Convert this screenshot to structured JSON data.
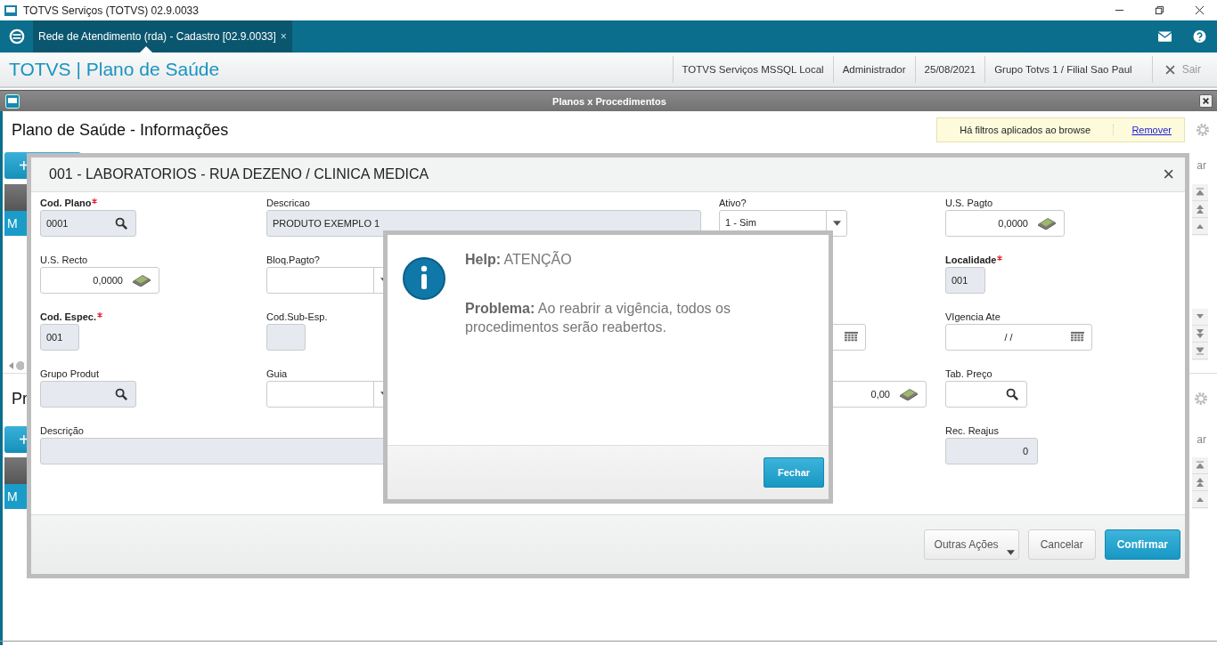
{
  "window": {
    "title": "TOTVS Serviços (TOTVS) 02.9.0033"
  },
  "tabs": [
    {
      "label": "Rede de Atendimento (rda) - Cadastro [02.9.0033]",
      "close": "×",
      "selected": true
    }
  ],
  "header": {
    "brand": "TOTVS | Plano de Saúde",
    "info": [
      "TOTVS Serviços MSSQL Local",
      "Administrador",
      "25/08/2021",
      "Grupo Totvs 1 / Filial Sao Paul"
    ],
    "exit": "Sair"
  },
  "inner_window": {
    "title": "Planos x Procedimentos"
  },
  "background": {
    "title": "Plano de Saúde - Informações",
    "filter_notice": "Há filtros aplicados ao browse",
    "filter_link": "Remover",
    "add_buttons": [
      "+",
      "+"
    ],
    "row_texts": [
      "M",
      "M"
    ],
    "second_title": "Pr",
    "cut_texts": [
      "ar",
      "ar"
    ]
  },
  "form": {
    "title": "001 - LABORATORIOS - RUA DEZENO / CLINICA MEDICA",
    "close": "×",
    "fields": [
      {
        "label": "Cod. Plano",
        "required": true,
        "kind": "lookup",
        "readonly": true,
        "value": "0001"
      },
      {
        "label": "Descricao",
        "required": false,
        "kind": "text",
        "readonly": true,
        "value": "PRODUTO EXEMPLO 1"
      },
      {
        "label": "Ativo?",
        "required": false,
        "kind": "select",
        "readonly": false,
        "value": "1 - Sim"
      },
      {
        "label": "U.S. Pagto",
        "required": false,
        "kind": "money",
        "readonly": false,
        "value": "0,0000"
      },
      {
        "label": "U.S. Recto",
        "required": false,
        "kind": "money",
        "readonly": false,
        "value": "0,0000"
      },
      {
        "label": "Bloq.Pagto?",
        "required": false,
        "kind": "select",
        "readonly": false
      },
      {
        "label": "Localidade",
        "required": true,
        "kind": "text",
        "readonly": true,
        "value": "001"
      },
      {
        "label": "Cod. Espec.",
        "required": true,
        "kind": "text",
        "readonly": true,
        "value": "001"
      },
      {
        "label": "Cod.Sub-Esp.",
        "required": false,
        "kind": "text",
        "readonly": true
      },
      {
        "kind": "date",
        "readonly": false
      },
      {
        "label": "VIgencia Ate",
        "required": false,
        "kind": "date",
        "readonly": false,
        "value": "/ /"
      },
      {
        "label": "Grupo Produt",
        "required": false,
        "kind": "lookup",
        "readonly": true
      },
      {
        "label": "Guia",
        "required": false,
        "kind": "select",
        "readonly": false
      },
      {
        "kind": "money",
        "readonly": false,
        "value": "0,00"
      },
      {
        "label": "Tab. Preço",
        "required": false,
        "kind": "lookup",
        "readonly": false
      },
      {
        "label": "Descrição",
        "required": false,
        "kind": "text",
        "readonly": true
      },
      {
        "label": "Rec. Reajus",
        "required": false,
        "kind": "number",
        "readonly": true,
        "value": "0"
      }
    ],
    "buttons": [
      {
        "label": "Outras Ações",
        "kind": "menu"
      },
      {
        "label": "Cancelar",
        "kind": "plain"
      },
      {
        "label": "Confirmar",
        "kind": "primary"
      }
    ]
  },
  "help": {
    "title": "**Help:** ATENÇÃO",
    "message": "**Problema:** Ao reabrir a vigência, todos os procedimentos serão reabertos.",
    "button": "Fechar"
  }
}
